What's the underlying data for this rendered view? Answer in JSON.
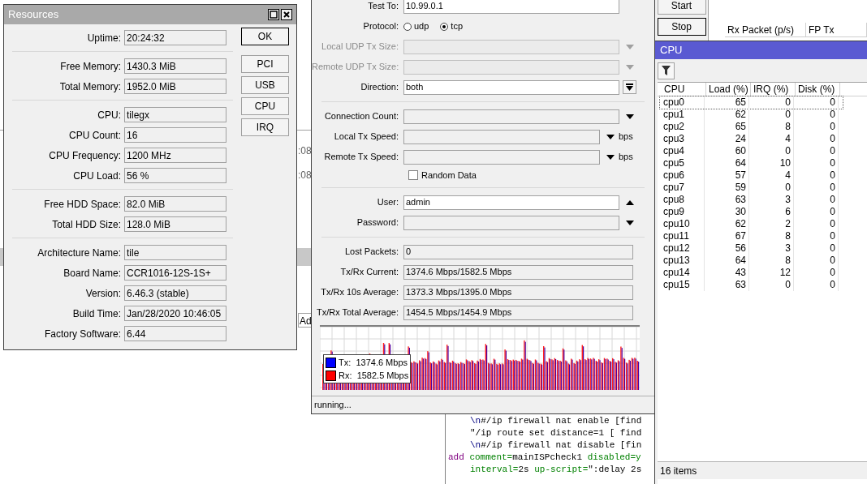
{
  "background_window": {
    "times": [
      ":08",
      ":08"
    ],
    "button": "Ad",
    "columns": [
      "Rx Packet (p/s)",
      "FP Tx"
    ]
  },
  "test_buttons": [
    {
      "label": "Start",
      "default": false
    },
    {
      "label": "Stop",
      "default": true
    }
  ],
  "resources": {
    "title": "Resources",
    "groups": [
      [
        {
          "label": "Uptime:",
          "value": "20:24:32"
        }
      ],
      [
        {
          "label": "Free Memory:",
          "value": "1430.3 MiB"
        },
        {
          "label": "Total Memory:",
          "value": "1952.0 MiB"
        }
      ],
      [
        {
          "label": "CPU:",
          "value": "tilegx"
        },
        {
          "label": "CPU Count:",
          "value": "16"
        },
        {
          "label": "CPU Frequency:",
          "value": "1200 MHz"
        },
        {
          "label": "CPU Load:",
          "value": "56 %"
        }
      ],
      [
        {
          "label": "Free HDD Space:",
          "value": "82.0 MiB"
        },
        {
          "label": "Total HDD Size:",
          "value": "128.0 MiB"
        }
      ],
      [
        {
          "label": "Architecture Name:",
          "value": "tile"
        },
        {
          "label": "Board Name:",
          "value": "CCR1016-12S-1S+"
        },
        {
          "label": "Version:",
          "value": "6.46.3 (stable)"
        },
        {
          "label": "Build Time:",
          "value": "Jan/28/2020 10:46:05"
        },
        {
          "label": "Factory Software:",
          "value": "6.44"
        }
      ]
    ],
    "buttons": [
      {
        "label": "OK",
        "default": true
      },
      {
        "label": "PCI",
        "default": false
      },
      {
        "label": "USB",
        "default": false
      },
      {
        "label": "CPU",
        "default": false
      },
      {
        "label": "IRQ",
        "default": false
      }
    ]
  },
  "bandwidth_test": {
    "groups": [
      [
        {
          "kind": "input",
          "label": "Test To:",
          "value": "10.99.0.1",
          "disabled": false
        },
        {
          "kind": "radio",
          "label": "Protocol:",
          "options": [
            {
              "label": "udp",
              "selected": false
            },
            {
              "label": "tcp",
              "selected": true
            }
          ],
          "disabled": false
        },
        {
          "kind": "combo",
          "label": "Local UDP Tx Size:",
          "disabled": true
        },
        {
          "kind": "combo",
          "label": "Remote UDP Tx Size:",
          "disabled": true
        },
        {
          "kind": "dropdown",
          "label": "Direction:",
          "value": "both",
          "disabled": false
        }
      ],
      [
        {
          "kind": "combo",
          "label": "Connection Count:",
          "disabled": false
        },
        {
          "kind": "combo",
          "label": "Local Tx Speed:",
          "disabled": false,
          "unit": "bps"
        },
        {
          "kind": "combo",
          "label": "Remote Tx Speed:",
          "disabled": false,
          "unit": "bps"
        },
        {
          "kind": "checkbox",
          "label": "Random Data",
          "checked": false
        }
      ],
      [
        {
          "kind": "expanded",
          "label": "User:",
          "value": "admin",
          "disabled": false
        },
        {
          "kind": "combo",
          "label": "Password:",
          "disabled": false
        }
      ],
      [
        {
          "kind": "readonly",
          "label": "Lost Packets:",
          "value": "0"
        },
        {
          "kind": "readonly",
          "label": "Tx/Rx Current:",
          "value": "1374.6 Mbps/1582.5 Mbps"
        },
        {
          "kind": "readonly",
          "label": "Tx/Rx 10s Average:",
          "value": "1373.3 Mbps/1395.0 Mbps"
        },
        {
          "kind": "readonly",
          "label": "Tx/Rx Total Average:",
          "value": "1454.5 Mbps/1454.9 Mbps"
        }
      ]
    ],
    "legend": [
      {
        "label": "Tx:",
        "value": "1374.6 Mbps",
        "color": "#0000ff"
      },
      {
        "label": "Rx:",
        "value": "1582.5 Mbps",
        "color": "#ff0000"
      }
    ],
    "status": "running..."
  },
  "code": [
    [
      {
        "kind": "escape",
        "text": "\\n"
      },
      {
        "kind": "text",
        "text": "#/ip firewall nat enable [find"
      }
    ],
    [
      {
        "kind": "text",
        "text": "\"/ip route set distance=1 [ find"
      }
    ],
    [
      {
        "kind": "escape",
        "text": "\\n"
      },
      {
        "kind": "text",
        "text": "#/ip firewall nat disable [fin"
      }
    ],
    [
      {
        "kind": "keyword",
        "text": "add "
      },
      {
        "kind": "param",
        "text": "comment="
      },
      {
        "kind": "text",
        "text": "mainISPcheck1 "
      },
      {
        "kind": "param",
        "text": "disabled=y"
      }
    ],
    [
      {
        "kind": "param",
        "text": "interval="
      },
      {
        "kind": "text",
        "text": "2s "
      },
      {
        "kind": "param",
        "text": "up-script="
      },
      {
        "kind": "text",
        "text": "\":delay 2s"
      }
    ]
  ],
  "cpu": {
    "title": "CPU",
    "columns": [
      "CPU",
      "Load (%)",
      "IRQ (%)",
      "Disk (%)"
    ],
    "rows": [
      {
        "cells": [
          "cpu0",
          "65",
          "0",
          "0"
        ],
        "selected": true
      },
      {
        "cells": [
          "cpu1",
          "62",
          "0",
          "0"
        ],
        "selected": false
      },
      {
        "cells": [
          "cpu2",
          "65",
          "8",
          "0"
        ],
        "selected": false
      },
      {
        "cells": [
          "cpu3",
          "24",
          "4",
          "0"
        ],
        "selected": false
      },
      {
        "cells": [
          "cpu4",
          "60",
          "0",
          "0"
        ],
        "selected": false
      },
      {
        "cells": [
          "cpu5",
          "64",
          "10",
          "0"
        ],
        "selected": false
      },
      {
        "cells": [
          "cpu6",
          "57",
          "4",
          "0"
        ],
        "selected": false
      },
      {
        "cells": [
          "cpu7",
          "59",
          "0",
          "0"
        ],
        "selected": false
      },
      {
        "cells": [
          "cpu8",
          "63",
          "3",
          "0"
        ],
        "selected": false
      },
      {
        "cells": [
          "cpu9",
          "30",
          "6",
          "0"
        ],
        "selected": false
      },
      {
        "cells": [
          "cpu10",
          "62",
          "2",
          "0"
        ],
        "selected": false
      },
      {
        "cells": [
          "cpu11",
          "67",
          "8",
          "0"
        ],
        "selected": false
      },
      {
        "cells": [
          "cpu12",
          "56",
          "3",
          "0"
        ],
        "selected": false
      },
      {
        "cells": [
          "cpu13",
          "64",
          "8",
          "0"
        ],
        "selected": false
      },
      {
        "cells": [
          "cpu14",
          "43",
          "12",
          "0"
        ],
        "selected": false
      },
      {
        "cells": [
          "cpu15",
          "63",
          "0",
          "0"
        ],
        "selected": false
      }
    ],
    "footer": "16 items"
  }
}
